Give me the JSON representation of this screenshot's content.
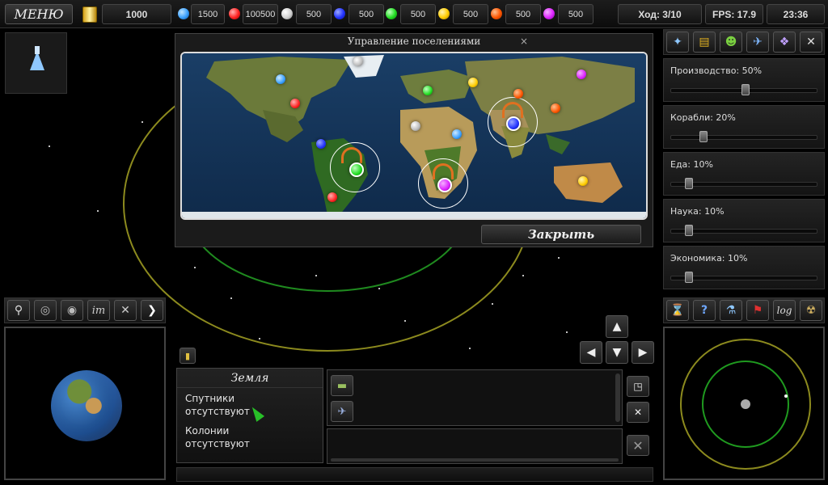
{
  "topbar": {
    "menu_label": "МЕНЮ",
    "gold": "1000",
    "resources": [
      {
        "color": "#3aa0ff",
        "value": "1500"
      },
      {
        "color": "#ff2222",
        "value": "100500"
      },
      {
        "color": "#e0e0e0",
        "value": "500"
      },
      {
        "color": "#2233ff",
        "value": "500"
      },
      {
        "color": "#22dd22",
        "value": "500"
      },
      {
        "color": "#ffcc00",
        "value": "500"
      },
      {
        "color": "#ff5500",
        "value": "500"
      },
      {
        "color": "#dd22ff",
        "value": "500"
      }
    ],
    "turn": "Ход: 3/10",
    "fps": "FPS: 17.9",
    "clock": "23:36"
  },
  "settlements": {
    "title": "Управление поселениями",
    "close_label": "Закрыть",
    "close_x": "×"
  },
  "sliders": [
    {
      "label": "Производство: 50%",
      "value": 50
    },
    {
      "label": "Корабли: 20%",
      "value": 20
    },
    {
      "label": "Еда: 10%",
      "value": 10
    },
    {
      "label": "Наука: 10%",
      "value": 10
    },
    {
      "label": "Экономика: 10%",
      "value": 10
    }
  ],
  "planet_info": {
    "name": "Земля",
    "satellites_label": "Спутники",
    "satellites_value": "отсутствуют",
    "colonies_label": "Колонии",
    "colonies_value": "отсутствуют"
  },
  "left_toolbar": {
    "im_label": "im"
  },
  "right_toolbar": {
    "log_label": "log"
  }
}
